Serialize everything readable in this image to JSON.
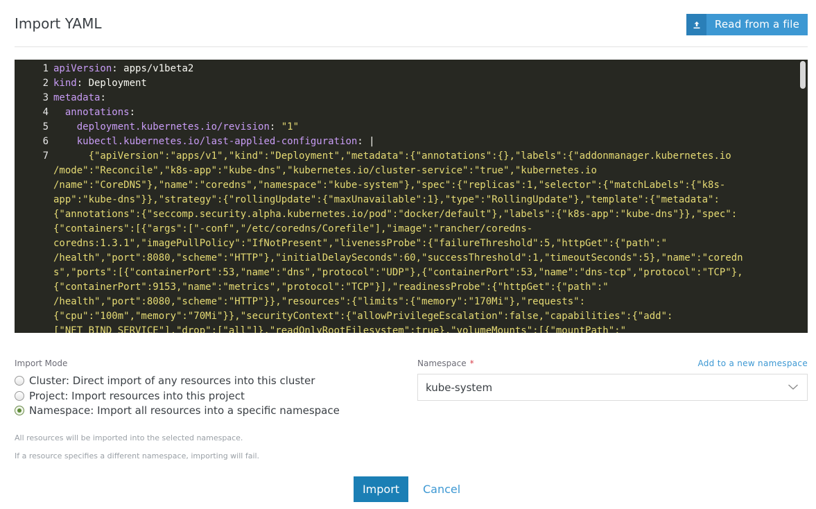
{
  "header": {
    "title": "Import YAML",
    "read_file_label": "Read from a file"
  },
  "editor": {
    "lines": [
      {
        "num": "1",
        "key": "apiVersion",
        "sep": ": ",
        "value": "apps/v1beta2",
        "indent": ""
      },
      {
        "num": "2",
        "key": "kind",
        "sep": ": ",
        "value": "Deployment",
        "indent": ""
      },
      {
        "num": "3",
        "key": "metadata",
        "sep": ":",
        "value": "",
        "indent": ""
      },
      {
        "num": "4",
        "key": "annotations",
        "sep": ":",
        "value": "",
        "indent": "  "
      },
      {
        "num": "5",
        "key": "deployment.kubernetes.io/revision",
        "sep": ": ",
        "value": "\"1\"",
        "indent": "    ",
        "string": true
      },
      {
        "num": "6",
        "key": "kubectl.kubernetes.io/last-applied-configuration",
        "sep": ": ",
        "value": "|",
        "indent": "    "
      }
    ],
    "json_line_num": "7",
    "json_lines": [
      "      {\"apiVersion\":\"apps/v1\",\"kind\":\"Deployment\",\"metadata\":{\"annotations\":{},\"labels\":{\"addonmanager.kubernetes.io",
      "/mode\":\"Reconcile\",\"k8s-app\":\"kube-dns\",\"kubernetes.io/cluster-service\":\"true\",\"kubernetes.io",
      "/name\":\"CoreDNS\"},\"name\":\"coredns\",\"namespace\":\"kube-system\"},\"spec\":{\"replicas\":1,\"selector\":{\"matchLabels\":{\"k8s-",
      "app\":\"kube-dns\"}},\"strategy\":{\"rollingUpdate\":{\"maxUnavailable\":1},\"type\":\"RollingUpdate\"},\"template\":{\"metadata\":",
      "{\"annotations\":{\"seccomp.security.alpha.kubernetes.io/pod\":\"docker/default\"},\"labels\":{\"k8s-app\":\"kube-dns\"}},\"spec\":",
      "{\"containers\":[{\"args\":[\"-conf\",\"/etc/coredns/Corefile\"],\"image\":\"rancher/coredns-",
      "coredns:1.3.1\",\"imagePullPolicy\":\"IfNotPresent\",\"livenessProbe\":{\"failureThreshold\":5,\"httpGet\":{\"path\":\"",
      "/health\",\"port\":8080,\"scheme\":\"HTTP\"},\"initialDelaySeconds\":60,\"successThreshold\":1,\"timeoutSeconds\":5},\"name\":\"coredn",
      "s\",\"ports\":[{\"containerPort\":53,\"name\":\"dns\",\"protocol\":\"UDP\"},{\"containerPort\":53,\"name\":\"dns-tcp\",\"protocol\":\"TCP\"},",
      "{\"containerPort\":9153,\"name\":\"metrics\",\"protocol\":\"TCP\"}],\"readinessProbe\":{\"httpGet\":{\"path\":\"",
      "/health\",\"port\":8080,\"scheme\":\"HTTP\"}},\"resources\":{\"limits\":{\"memory\":\"170Mi\"},\"requests\":",
      "{\"cpu\":\"100m\",\"memory\":\"70Mi\"}},\"securityContext\":{\"allowPrivilegeEscalation\":false,\"capabilities\":{\"add\":",
      "[\"NET_BIND_SERVICE\"],\"drop\":[\"all\"]},\"readOnlyRootFilesystem\":true},\"volumeMounts\":[{\"mountPath\":\""
    ]
  },
  "import_mode": {
    "label": "Import Mode",
    "options": [
      {
        "label": "Cluster: Direct import of any resources into this cluster",
        "checked": false
      },
      {
        "label": "Project: Import resources into this project",
        "checked": false
      },
      {
        "label": "Namespace: Import all resources into a specific namespace",
        "checked": true
      }
    ],
    "help1": "All resources will be imported into the selected namespace.",
    "help2": "If a resource specifies a different namespace, importing will fail."
  },
  "namespace": {
    "label": "Namespace",
    "required_mark": "*",
    "add_link": "Add to a new namespace",
    "value": "kube-system"
  },
  "footer": {
    "import_label": "Import",
    "cancel_label": "Cancel"
  },
  "colors": {
    "accent": "#3d98d3",
    "primary_button": "#1b7fb5",
    "editor_bg": "#272822",
    "yaml_key": "#c89cf5",
    "yaml_string": "#e6db74"
  }
}
